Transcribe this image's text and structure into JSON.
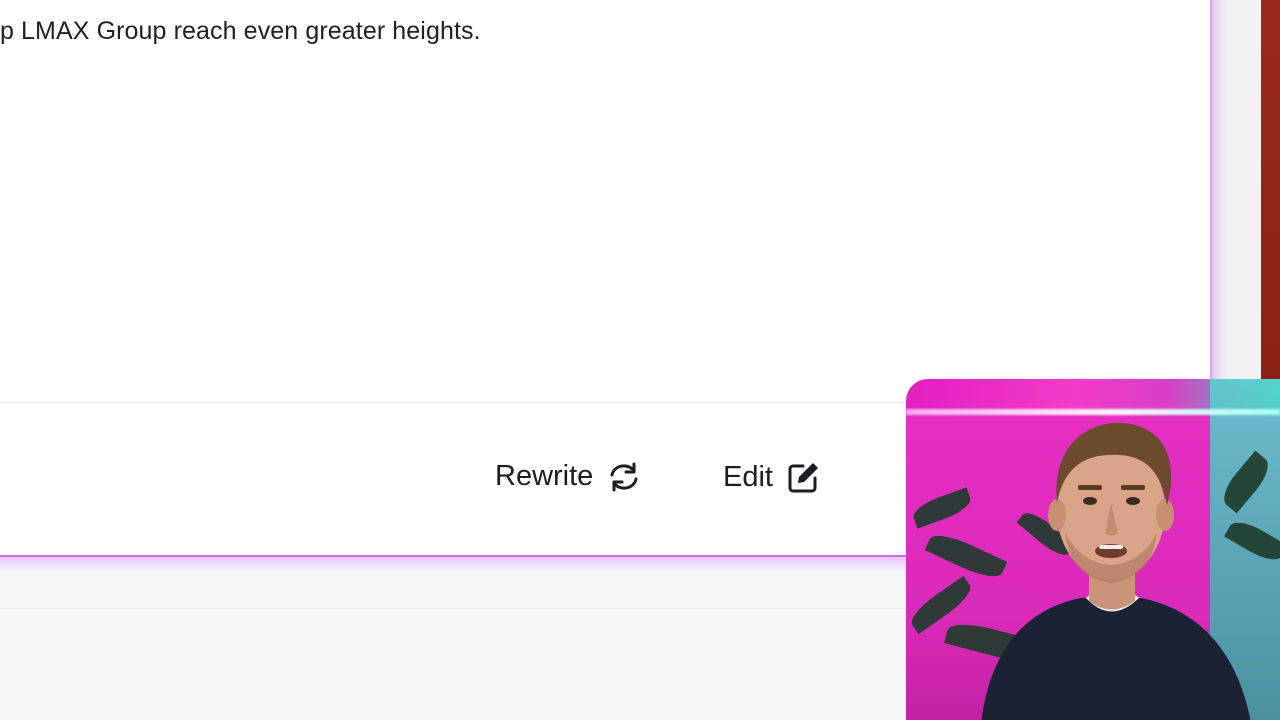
{
  "document": {
    "body_text": "p LMAX Group reach even greater heights."
  },
  "actions": {
    "rewrite_label": "Rewrite",
    "edit_label": "Edit"
  },
  "icons": {
    "rewrite": "refresh-icon",
    "edit": "edit-pencil-icon"
  },
  "colors": {
    "card_glow": "#c86cf0",
    "video_background": "#e21fc0",
    "text": "#1f1f24"
  }
}
